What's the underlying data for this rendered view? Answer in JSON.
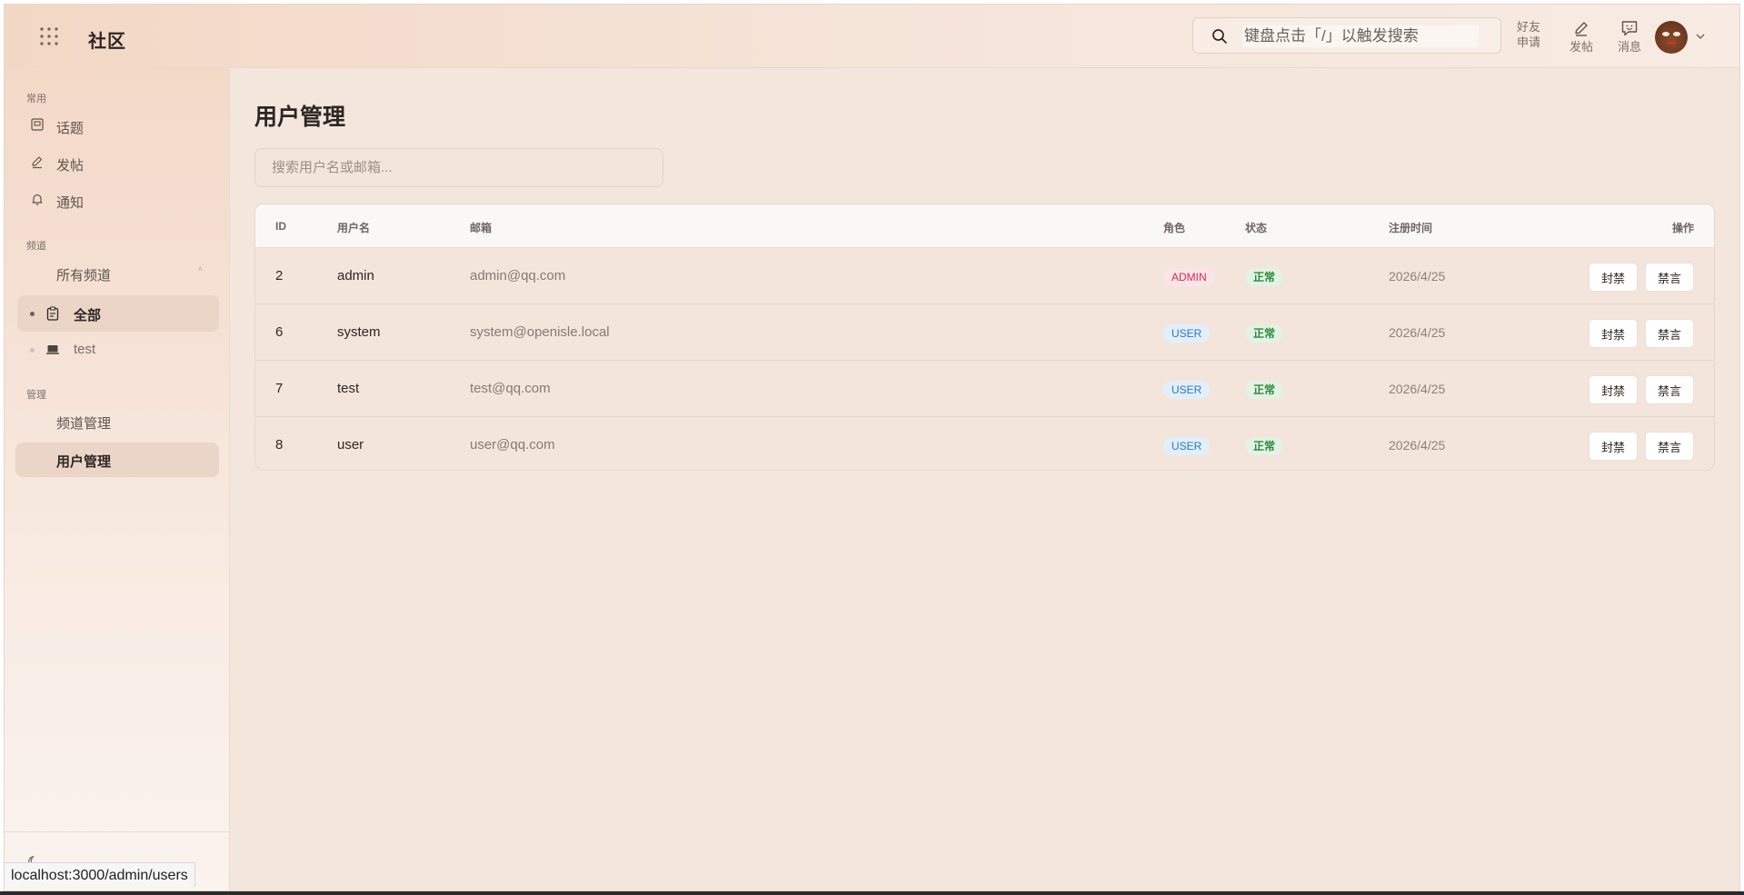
{
  "header": {
    "brand": "社区",
    "search_placeholder": "键盘点击「/」以触发搜索",
    "friend_request_label_1": "好友",
    "friend_request_label_2": "申请",
    "post_label": "发帖",
    "messages_label": "消息"
  },
  "sidebar": {
    "common_label": "常用",
    "common_items": [
      {
        "label": "话题",
        "icon": "topic-icon"
      },
      {
        "label": "发帖",
        "icon": "pencil-icon"
      },
      {
        "label": "通知",
        "icon": "bell-icon"
      }
    ],
    "channels_label": "频道",
    "all_channels_label": "所有频道",
    "channels": [
      {
        "label": "全部",
        "icon": "clipboard-icon",
        "active": true
      },
      {
        "label": "test",
        "icon": "laptop-icon",
        "active": false
      }
    ],
    "admin_label": "管理",
    "admin_items": [
      {
        "label": "频道管理",
        "active": false
      },
      {
        "label": "用户管理",
        "active": true
      }
    ]
  },
  "main": {
    "title": "用户管理",
    "search_placeholder": "搜索用户名或邮箱...",
    "columns": {
      "id": "ID",
      "username": "用户名",
      "email": "邮箱",
      "role": "角色",
      "status": "状态",
      "registered": "注册时间",
      "actions": "操作"
    },
    "rows": [
      {
        "id": "2",
        "username": "admin",
        "email": "admin@qq.com",
        "role": "ADMIN",
        "status": "正常",
        "registered": "2026/4/25",
        "ban": "封禁",
        "mute": "禁言"
      },
      {
        "id": "6",
        "username": "system",
        "email": "system@openisle.local",
        "role": "USER",
        "status": "正常",
        "registered": "2026/4/25",
        "ban": "封禁",
        "mute": "禁言"
      },
      {
        "id": "7",
        "username": "test",
        "email": "test@qq.com",
        "role": "USER",
        "status": "正常",
        "registered": "2026/4/25",
        "ban": "封禁",
        "mute": "禁言"
      },
      {
        "id": "8",
        "username": "user",
        "email": "user@qq.com",
        "role": "USER",
        "status": "正常",
        "registered": "2026/4/25",
        "ban": "封禁",
        "mute": "禁言"
      }
    ]
  },
  "status_bar_url": "localhost:3000/admin/users",
  "colors": {
    "background": "#f3e6dd",
    "admin_badge": "#d32f50",
    "user_badge": "#2a78c4",
    "ok_badge": "#2e8a3c"
  }
}
